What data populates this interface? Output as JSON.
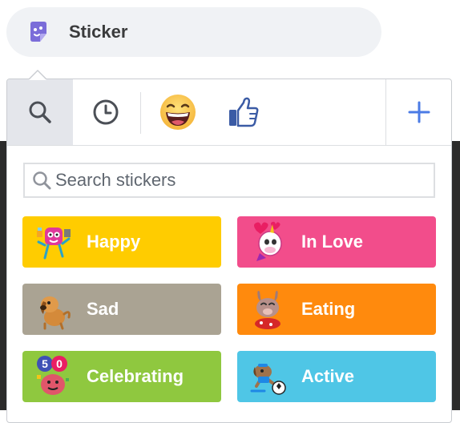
{
  "composer": {
    "label": "Sticker",
    "icon": "sticker-icon"
  },
  "tabs": [
    {
      "id": "search",
      "icon": "search-icon",
      "selected": true
    },
    {
      "id": "recent",
      "icon": "clock-icon",
      "selected": false
    },
    {
      "id": "laugh",
      "icon": "laughing-face-icon",
      "selected": false
    },
    {
      "id": "like",
      "icon": "thumbs-up-icon",
      "selected": false
    },
    {
      "id": "add",
      "icon": "plus-icon",
      "selected": false
    }
  ],
  "search": {
    "placeholder": "Search stickers"
  },
  "categories": [
    {
      "label": "Happy",
      "color": "#ffcc00",
      "icon": "happy-sticker-icon"
    },
    {
      "label": "In Love",
      "color": "#f24d8b",
      "icon": "unicorn-sticker-icon"
    },
    {
      "label": "Sad",
      "color": "#aaa393",
      "icon": "sad-dog-sticker-icon"
    },
    {
      "label": "Eating",
      "color": "#ff8a0d",
      "icon": "eating-bunny-sticker-icon"
    },
    {
      "label": "Celebrating",
      "color": "#8fc83f",
      "icon": "celebrating-sticker-icon"
    },
    {
      "label": "Active",
      "color": "#4fc6e6",
      "icon": "active-dog-sticker-icon"
    }
  ],
  "colors": {
    "accent": "#4b7be5",
    "sticker_icon": "#7b6dd9"
  }
}
